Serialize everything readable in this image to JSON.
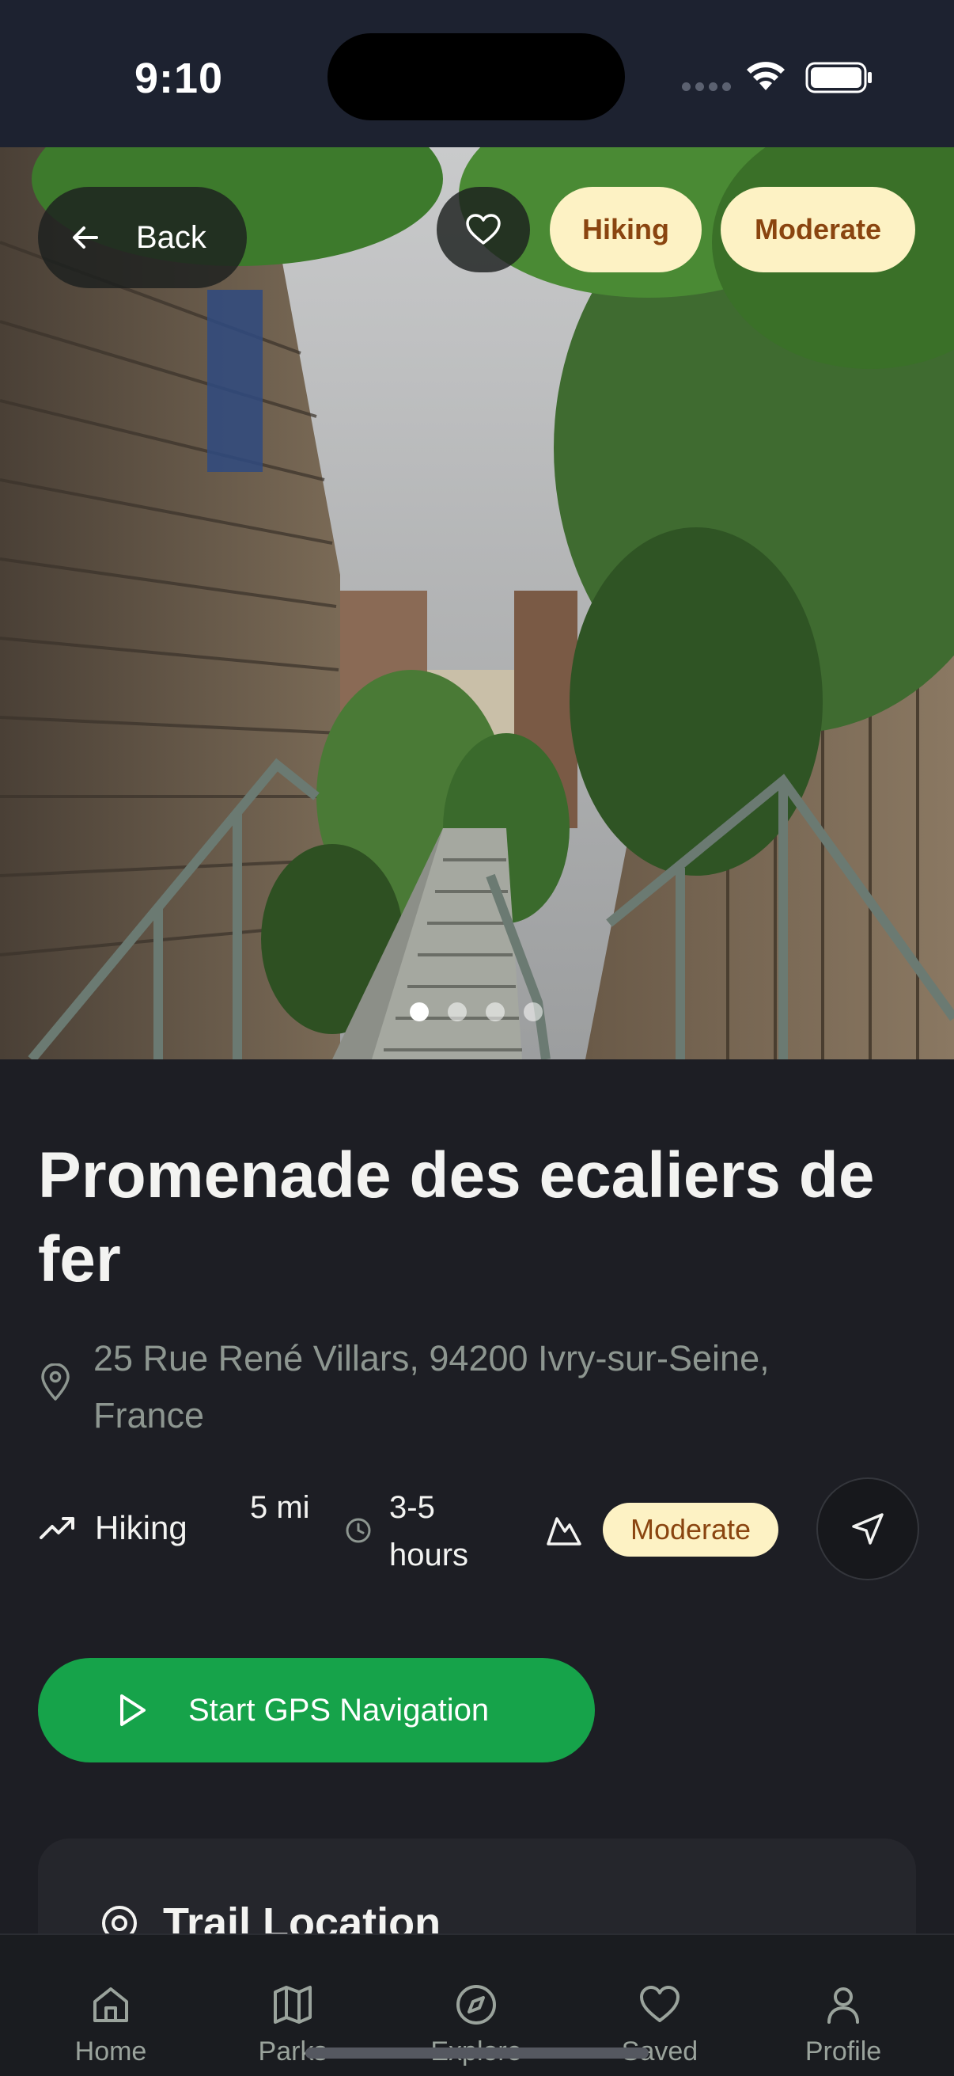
{
  "status_bar": {
    "time": "9:10"
  },
  "hero": {
    "back_label": "Back",
    "chips": [
      "Hiking",
      "Moderate"
    ],
    "image_count": 4,
    "active_image": 1
  },
  "trail": {
    "title": "Promenade des ecaliers de fer",
    "address": "25 Rue René Villars, 94200 Ivry-sur-Seine, France",
    "type": "Hiking",
    "distance": "5 mi",
    "duration": "3-5 hours",
    "difficulty": "Moderate"
  },
  "actions": {
    "gps_label": "Start GPS Navigation"
  },
  "card": {
    "title": "Trail Location"
  },
  "nav": {
    "items": [
      {
        "label": "Home",
        "icon": "home-icon"
      },
      {
        "label": "Parks",
        "icon": "map-icon"
      },
      {
        "label": "Explore",
        "icon": "compass-icon"
      },
      {
        "label": "Saved",
        "icon": "heart-icon"
      },
      {
        "label": "Profile",
        "icon": "user-icon"
      }
    ]
  },
  "colors": {
    "primary_green": "#16a34a",
    "chip_bg": "#fdf2c4",
    "chip_text": "#8a4510",
    "background": "#1d1e24"
  }
}
